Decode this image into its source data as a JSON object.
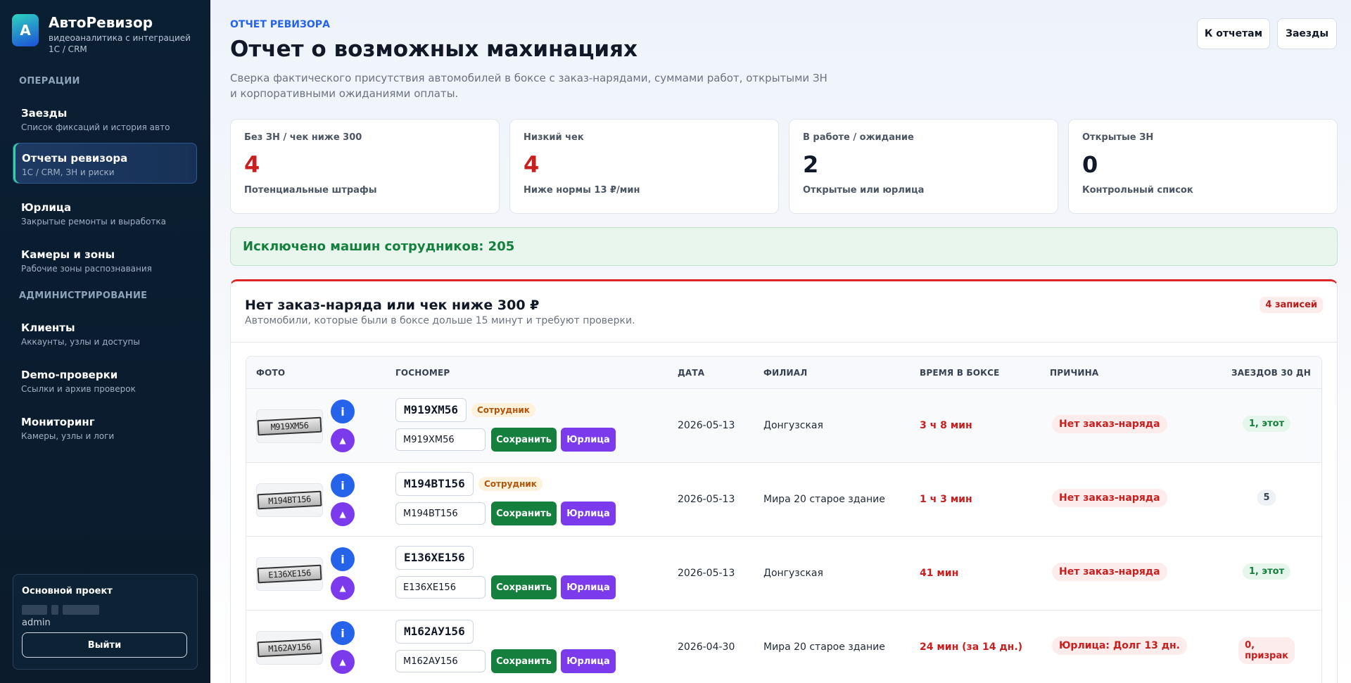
{
  "app": {
    "name": "АвтоРевизор",
    "subtitle": "видеоаналитика с интеграцией 1С / CRM",
    "logo_letter": "A"
  },
  "sidebar": {
    "sections": [
      "ОПЕРАЦИИ",
      "АДМИНИСТРИРОВАНИЕ"
    ],
    "items": [
      {
        "title": "Заезды",
        "sub": "Список фиксаций и история авто"
      },
      {
        "title": "Отчеты ревизора",
        "sub": "1С / CRM, ЗН и риски"
      },
      {
        "title": "Юрлица",
        "sub": "Закрытые ремонты и выработка"
      },
      {
        "title": "Камеры и зоны",
        "sub": "Рабочие зоны распознавания"
      },
      {
        "title": "Клиенты",
        "sub": "Аккаунты, узлы и доступы"
      },
      {
        "title": "Demo-проверки",
        "sub": "Ссылки и архив проверок"
      },
      {
        "title": "Мониторинг",
        "sub": "Камеры, узлы и логи"
      }
    ],
    "project": {
      "title": "Основной проект",
      "user": "admin",
      "logout": "Выйти"
    }
  },
  "header": {
    "eyebrow": "ОТЧЕТ РЕВИЗОРА",
    "title": "Отчет о возможных махинациях",
    "description": "Сверка фактического присутствия автомобилей в боксе с заказ-нарядами, суммами работ, открытыми ЗН и корпоративными ожиданиями оплаты.",
    "btn_reports": "К отчетам",
    "btn_visits": "Заезды"
  },
  "cards": [
    {
      "label": "Без ЗН / чек ниже 300",
      "value": "4",
      "note": "Потенциальные штрафы",
      "color": "#c81e1e"
    },
    {
      "label": "Низкий чек",
      "value": "4",
      "note": "Ниже нормы 13 ₽/мин",
      "color": "#c81e1e"
    },
    {
      "label": "В работе / ожидание",
      "value": "2",
      "note": "Открытые или юрлица",
      "color": "#111827"
    },
    {
      "label": "Открытые ЗН",
      "value": "0",
      "note": "Контрольный список",
      "color": "#111827"
    }
  ],
  "excluded": "Исключено машин сотрудников: 205",
  "panel": {
    "title": "Нет заказ-наряда или чек ниже 300 ₽",
    "subtitle": "Автомобили, которые были в боксе дольше 15 минут и требуют проверки.",
    "count": "4 записей",
    "columns": [
      "ФОТО",
      "ГОСНОМЕР",
      "ДАТА",
      "ФИЛИАЛ",
      "ВРЕМЯ В БОКСЕ",
      "ПРИЧИНА",
      "ЗАЕЗДОВ 30 ДН"
    ],
    "save_label": "Сохранить",
    "legal_label": "Юрлица",
    "info_glyph": "i",
    "up_glyph": "▲",
    "rows": [
      {
        "photo_text": "М919ХМ56",
        "plate": "М919ХМ56",
        "badge": "Сотрудник",
        "input": "М919ХМ56",
        "date": "2026-05-13",
        "branch": "Донгузская",
        "time": "3 ч 8 мин",
        "reason": "Нет заказ-наряда",
        "visits": "1, этот",
        "visits_style": "green"
      },
      {
        "photo_text": "М194ВТ156",
        "plate": "М194ВТ156",
        "badge": "Сотрудник",
        "input": "М194ВТ156",
        "date": "2026-05-13",
        "branch": "Мира 20 старое здание",
        "time": "1 ч 3 мин",
        "reason": "Нет заказ-наряда",
        "visits": "5",
        "visits_style": "gray"
      },
      {
        "photo_text": "Е136ХЕ156",
        "plate": "Е136ХЕ156",
        "badge": "",
        "input": "Е136ХЕ156",
        "date": "2026-05-13",
        "branch": "Донгузская",
        "time": "41 мин",
        "reason": "Нет заказ-наряда",
        "visits": "1, этот",
        "visits_style": "green"
      },
      {
        "photo_text": "М162АУ156",
        "plate": "М162АУ156",
        "badge": "",
        "input": "М162АУ156",
        "date": "2026-04-30",
        "branch": "Мира 20 старое здание",
        "time": "24 мин (за 14 дн.)",
        "reason": "Юрлица: Долг 13 дн.",
        "visits": "0, призрак",
        "visits_style": "red"
      }
    ]
  }
}
